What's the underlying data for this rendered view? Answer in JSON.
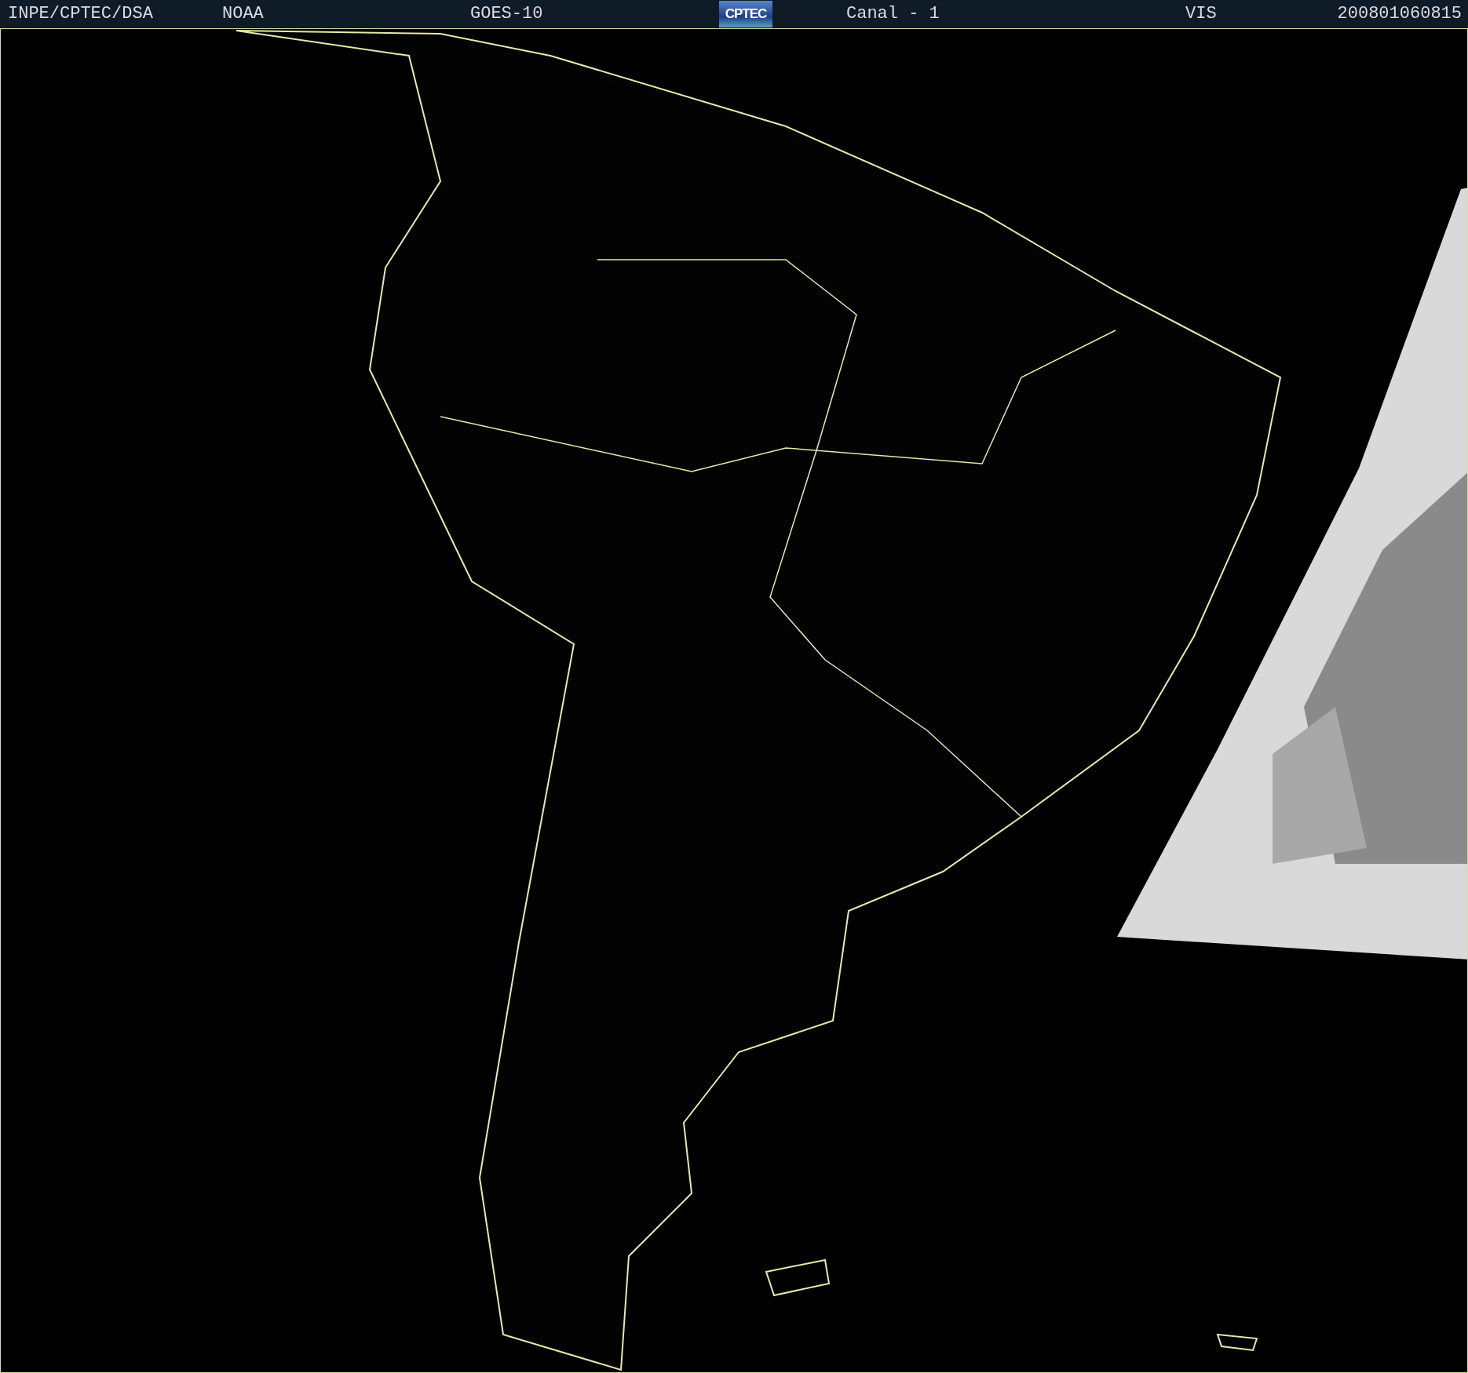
{
  "header": {
    "items": [
      {
        "kind": "text",
        "text": "INPE/CPTEC/DSA"
      },
      {
        "kind": "text",
        "text": "NOAA"
      },
      {
        "kind": "text",
        "text": "GOES-10"
      },
      {
        "kind": "logo",
        "text": "CPTEC"
      },
      {
        "kind": "text",
        "text": "Canal - 1"
      },
      {
        "kind": "text",
        "text": "VIS"
      },
      {
        "kind": "text",
        "text": "200801060815"
      }
    ]
  }
}
